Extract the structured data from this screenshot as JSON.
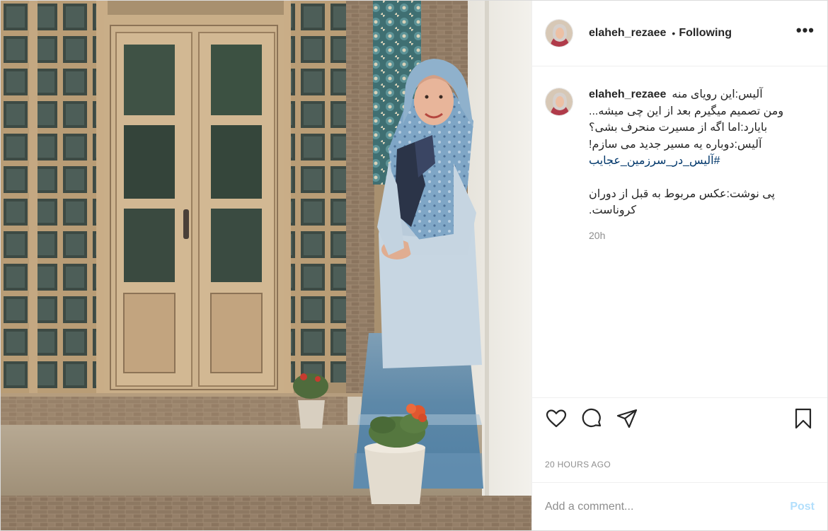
{
  "post": {
    "author": {
      "username": "elaheh_rezaee",
      "follow_status": "Following",
      "separator": "•",
      "more_label": "•••"
    },
    "caption": {
      "username": "elaheh_rezaee",
      "lines": [
        "آلیس:این رویای منه",
        "ومن تصمیم میگیرم بعد از این چی میشه...",
        "بایارد:اما اگه از مسیرت منحرف بشی؟",
        "آلیس:دوباره یه مسیر جدید می سازم!",
        "#آلیس_در_سرزمین_عجایب",
        "",
        "پی نوشت:عکس مربوط به قبل از دوران",
        "کروناست."
      ],
      "time": "20h"
    },
    "actions": {
      "like": "heart-icon",
      "comment": "comment-icon",
      "share": "share-icon",
      "save": "bookmark-icon"
    },
    "timestamp": "20 HOURS AGO",
    "add_comment": {
      "placeholder": "Add a comment...",
      "post_label": "Post"
    },
    "image": {
      "description_alt": "photo"
    }
  }
}
